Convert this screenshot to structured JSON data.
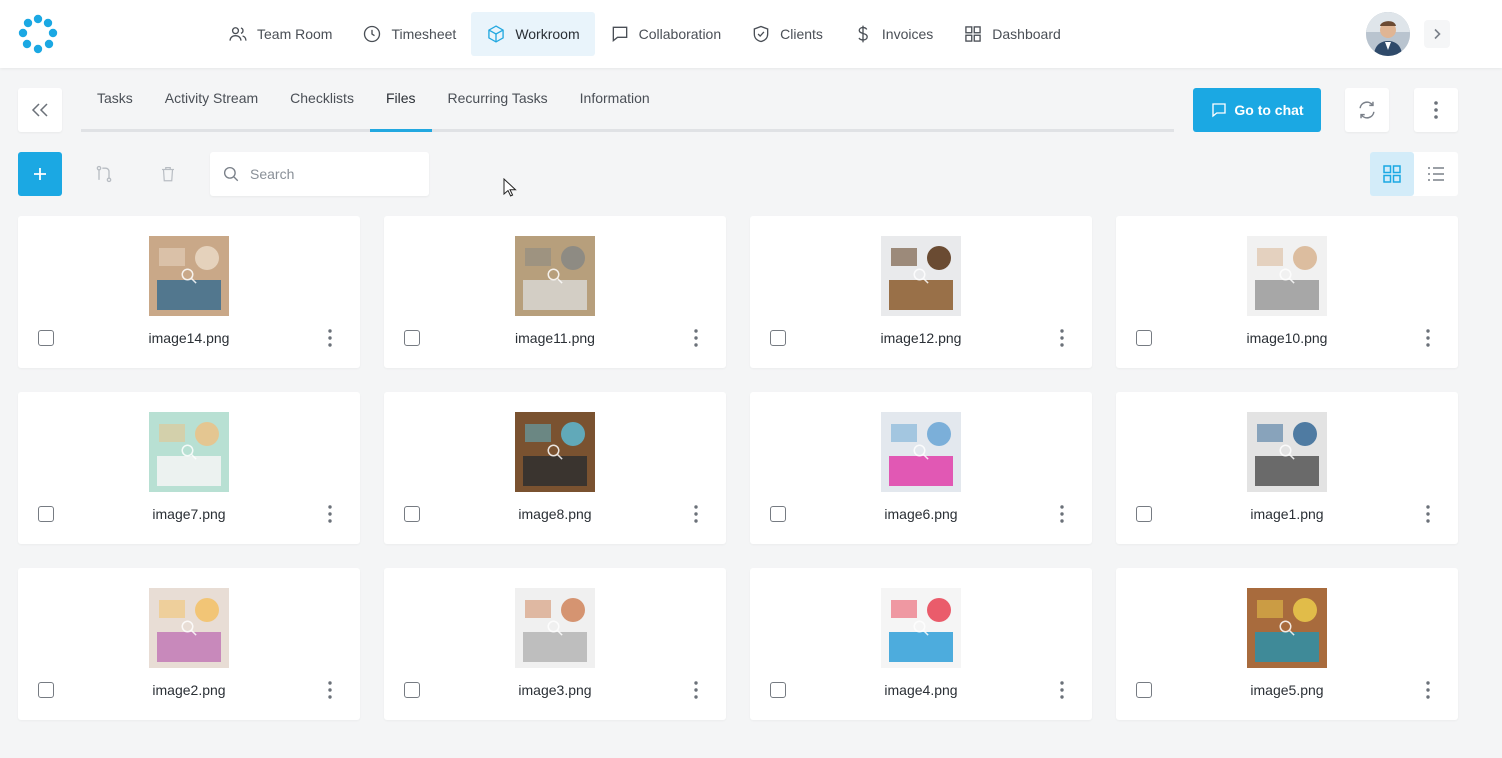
{
  "nav": {
    "items": [
      {
        "label": "Team Room",
        "icon": "users-icon"
      },
      {
        "label": "Timesheet",
        "icon": "clock-icon"
      },
      {
        "label": "Workroom",
        "icon": "cube-icon",
        "active": true
      },
      {
        "label": "Collaboration",
        "icon": "chat-bubble-icon"
      },
      {
        "label": "Clients",
        "icon": "shield-check-icon"
      },
      {
        "label": "Invoices",
        "icon": "dollar-icon"
      },
      {
        "label": "Dashboard",
        "icon": "grid-icon"
      }
    ]
  },
  "tabs": [
    {
      "label": "Tasks"
    },
    {
      "label": "Activity Stream"
    },
    {
      "label": "Checklists"
    },
    {
      "label": "Files",
      "active": true
    },
    {
      "label": "Recurring Tasks"
    },
    {
      "label": "Information"
    }
  ],
  "actions": {
    "chat_label": "Go to chat"
  },
  "search": {
    "placeholder": "Search",
    "value": ""
  },
  "view": {
    "mode": "grid"
  },
  "colors": {
    "accent": "#1ba8e3",
    "active_nav_bg": "#e9f4fb",
    "page_bg": "#f4f5f6"
  },
  "files": [
    {
      "name": "image14.png",
      "palette": [
        "#c9a888",
        "#3d6f8f",
        "#e8d6c2"
      ]
    },
    {
      "name": "image11.png",
      "palette": [
        "#b79f7c",
        "#d8d6d2",
        "#8a8884"
      ]
    },
    {
      "name": "image12.png",
      "palette": [
        "#e9eaec",
        "#8b5a2b",
        "#5c3a1e"
      ]
    },
    {
      "name": "image10.png",
      "palette": [
        "#f1f1f1",
        "#9a9a9a",
        "#d9b796"
      ]
    },
    {
      "name": "image7.png",
      "palette": [
        "#b8e0d3",
        "#f5f5f5",
        "#e9c38a"
      ]
    },
    {
      "name": "image8.png",
      "palette": [
        "#7a5230",
        "#2f2f2f",
        "#5eb3c9"
      ]
    },
    {
      "name": "image6.png",
      "palette": [
        "#e3e8ee",
        "#e03ea9",
        "#6fa9d6"
      ]
    },
    {
      "name": "image1.png",
      "palette": [
        "#e3e3e3",
        "#555555",
        "#3e6f9a"
      ]
    },
    {
      "name": "image2.png",
      "palette": [
        "#e8ddd5",
        "#c27ab6",
        "#f3c26b"
      ]
    },
    {
      "name": "image3.png",
      "palette": [
        "#f0f0f0",
        "#b5b5b5",
        "#d18a63"
      ]
    },
    {
      "name": "image4.png",
      "palette": [
        "#f5f5f5",
        "#2f9fd8",
        "#e94b5c"
      ]
    },
    {
      "name": "image5.png",
      "palette": [
        "#a86b3d",
        "#2d8fa8",
        "#e7c54a"
      ]
    }
  ]
}
